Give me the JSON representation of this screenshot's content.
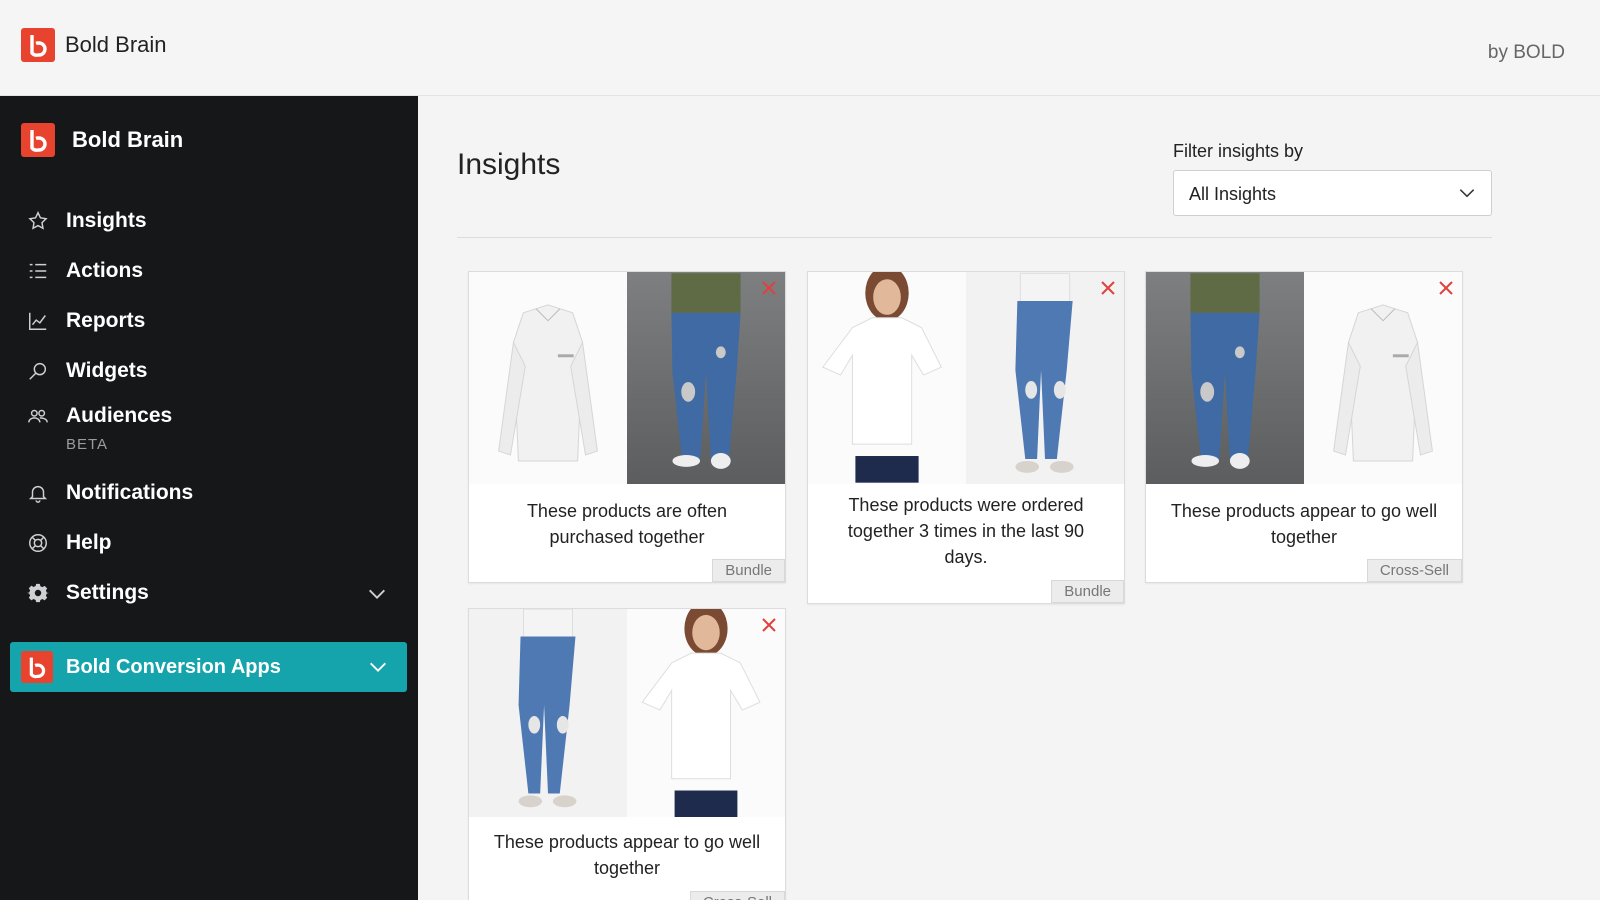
{
  "header": {
    "title": "Bold Brain",
    "byline": "by BOLD"
  },
  "sidebar": {
    "brand": "Bold Brain",
    "items": [
      {
        "label": "Insights",
        "icon": "star-icon"
      },
      {
        "label": "Actions",
        "icon": "list-icon"
      },
      {
        "label": "Reports",
        "icon": "line-chart-icon"
      },
      {
        "label": "Widgets",
        "icon": "search-icon"
      },
      {
        "label": "Audiences",
        "badge": "BETA",
        "icon": "users-icon"
      },
      {
        "label": "Notifications",
        "icon": "bell-icon"
      },
      {
        "label": "Help",
        "icon": "lifebuoy-icon"
      },
      {
        "label": "Settings",
        "icon": "gear-icon"
      }
    ],
    "apps_button": "Bold Conversion Apps"
  },
  "main": {
    "title": "Insights",
    "filter": {
      "label": "Filter insights by",
      "value": "All Insights"
    },
    "cards": [
      {
        "text": "These products are often purchased together",
        "tag": "Bundle",
        "products": [
          "white-shirt",
          "ripped-jeans-model"
        ]
      },
      {
        "text": "These products were ordered together 3 times in the last 90 days.",
        "tag": "Bundle",
        "products": [
          "white-tshirt",
          "skinny-jeans"
        ]
      },
      {
        "text": "These products appear to go well together",
        "tag": "Cross-Sell",
        "products": [
          "ripped-jeans-model",
          "white-shirt"
        ]
      },
      {
        "text": "These products appear to go well together",
        "tag": "Cross-Sell",
        "products": [
          "skinny-jeans",
          "white-tshirt"
        ]
      }
    ]
  },
  "colors": {
    "brand_red": "#e8432e",
    "accent_teal": "#15a4ab",
    "sidebar_bg": "#161719",
    "close_red": "#e0413c"
  }
}
